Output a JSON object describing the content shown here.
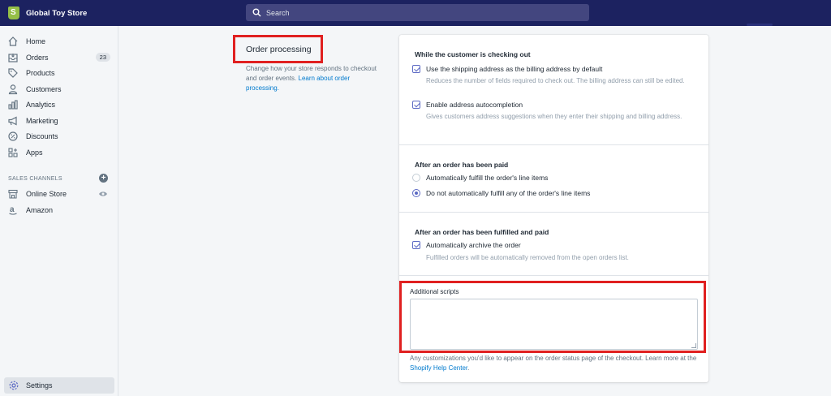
{
  "topbar": {
    "store_name": "Global Toy Store",
    "search_placeholder": "Search",
    "bg_color": "#1c2260"
  },
  "sidebar": {
    "items": [
      {
        "label": "Home",
        "icon": "home-icon"
      },
      {
        "label": "Orders",
        "icon": "orders-icon",
        "badge": "23"
      },
      {
        "label": "Products",
        "icon": "tag-icon"
      },
      {
        "label": "Customers",
        "icon": "person-icon"
      },
      {
        "label": "Analytics",
        "icon": "bar-chart-icon"
      },
      {
        "label": "Marketing",
        "icon": "megaphone-icon"
      },
      {
        "label": "Discounts",
        "icon": "discount-icon"
      },
      {
        "label": "Apps",
        "icon": "apps-icon"
      }
    ],
    "channels_heading": "SALES CHANNELS",
    "channels": [
      {
        "label": "Online Store",
        "icon": "store-icon"
      },
      {
        "label": "Amazon",
        "icon": "amazon-icon"
      }
    ],
    "settings_label": "Settings"
  },
  "section": {
    "title": "Order processing",
    "description": "Change how your store responds to checkout and order events.",
    "link": "Learn about order processing."
  },
  "checkout": {
    "title": "While the customer is checking out",
    "options": [
      {
        "label": "Use the shipping address as the billing address by default",
        "checked": true,
        "help": "Reduces the number of fields required to check out. The billing address can still be edited."
      },
      {
        "label": "Enable address autocompletion",
        "checked": true,
        "help": "Gives customers address suggestions when they enter their shipping and billing address."
      }
    ]
  },
  "paid": {
    "title": "After an order has been paid",
    "options": [
      {
        "label": "Automatically fulfill the order's line items",
        "selected": false
      },
      {
        "label": "Do not automatically fulfill any of the order's line items",
        "selected": true
      }
    ]
  },
  "fulfilled": {
    "title": "After an order has been fulfilled and paid",
    "option": {
      "label": "Automatically archive the order",
      "checked": true,
      "help": "Fulfilled orders will be automatically removed from the open orders list."
    }
  },
  "scripts": {
    "label": "Additional scripts",
    "value": "",
    "help": "Any customizations you'd like to appear on the order status page of the checkout. Learn more at the",
    "link": "Shopify Help Center",
    "help_end": "."
  },
  "colors": {
    "accent": "#5c6ac4",
    "link": "#007ace",
    "highlight": "#e02020"
  }
}
